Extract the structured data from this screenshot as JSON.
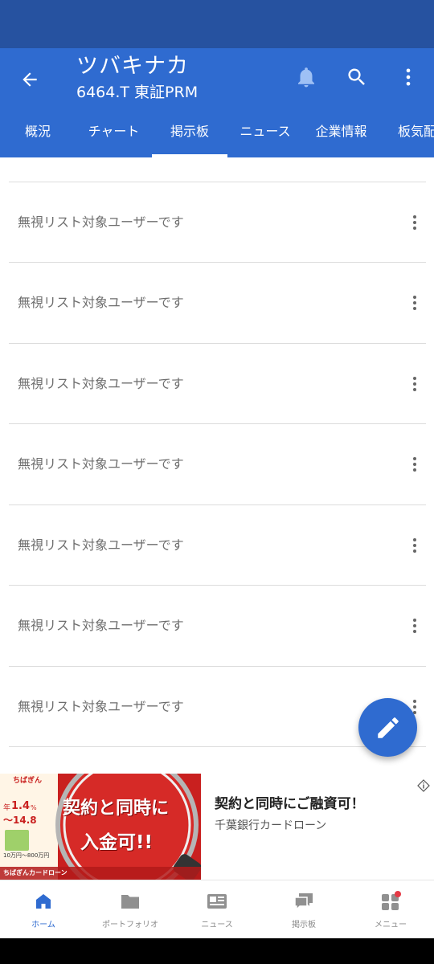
{
  "header": {
    "title": "ツバキナカ",
    "subtitle": "6464.T 東証PRM",
    "accent": "#2f6bd0"
  },
  "tabs": [
    {
      "label": "概況",
      "active": false
    },
    {
      "label": "チャート",
      "active": false
    },
    {
      "label": "掲示板",
      "active": true
    },
    {
      "label": "ニュース",
      "active": false
    },
    {
      "label": "企業情報",
      "active": false
    },
    {
      "label": "板気配",
      "active": false
    }
  ],
  "posts": [
    {
      "text": "無視リスト対象ユーザーです"
    },
    {
      "text": "無視リスト対象ユーザーです"
    },
    {
      "text": "無視リスト対象ユーザーです"
    },
    {
      "text": "無視リスト対象ユーザーです"
    },
    {
      "text": "無視リスト対象ユーザーです"
    },
    {
      "text": "無視リスト対象ユーザーです"
    },
    {
      "text": "無視リスト対象ユーザーです"
    }
  ],
  "ad": {
    "brand": "ちばぎん",
    "rate_prefix": "年",
    "rate_low": "1.4",
    "rate_high": "～14.8",
    "percent": "%",
    "limit": "10万円～800万円",
    "product": "ちばぎんカードローン",
    "overlay_line1": "契約と同時に",
    "overlay_line2": "入金可!!",
    "headline": "契約と同時にご融資可！",
    "sponsor": "千葉銀行カードローン"
  },
  "bottom_nav": [
    {
      "label": "ホーム",
      "icon": "home-icon",
      "active": true
    },
    {
      "label": "ポートフォリオ",
      "icon": "folder-icon",
      "active": false
    },
    {
      "label": "ニュース",
      "icon": "news-icon",
      "active": false
    },
    {
      "label": "掲示板",
      "icon": "chat-icon",
      "active": false
    },
    {
      "label": "メニュー",
      "icon": "grid-menu-icon",
      "active": false
    }
  ]
}
